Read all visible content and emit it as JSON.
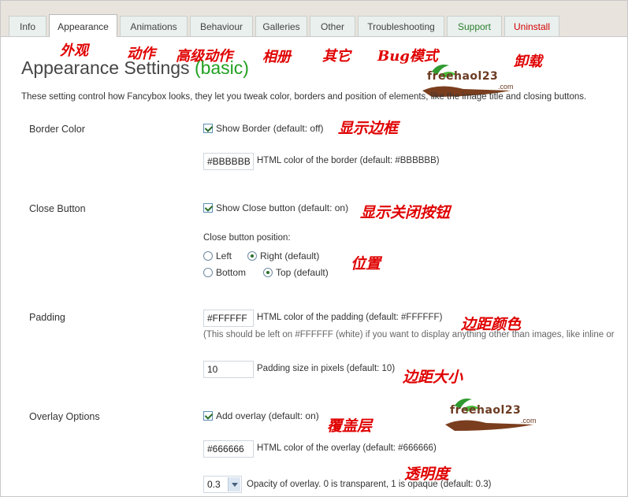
{
  "tabs": [
    {
      "label": "Info"
    },
    {
      "label": "Appearance"
    },
    {
      "label": "Animations"
    },
    {
      "label": "Behaviour"
    },
    {
      "label": "Galleries"
    },
    {
      "label": "Other"
    },
    {
      "label": "Troubleshooting"
    },
    {
      "label": "Support"
    },
    {
      "label": "Uninstall"
    }
  ],
  "annotations": {
    "appearance": "外观",
    "animations": "动作",
    "behaviour": "高级动作",
    "galleries": "相册",
    "other": "其它",
    "troubleshooting": "Bug模式",
    "uninstall": "卸载",
    "show_border": "显示边框",
    "show_close": "显示关闭按钮",
    "position": "位置",
    "padding_color": "边距颜色",
    "padding_size": "边距大小",
    "overlay": "覆盖层",
    "opacity": "透明度"
  },
  "watermark": {
    "brand": "freehaol23",
    "domain": ".com"
  },
  "page": {
    "title": "Appearance Settings",
    "title_suffix": "(basic)",
    "description": "These setting control how Fancybox looks, they let you tweak color, borders and position of elements, like the image title and closing buttons."
  },
  "border": {
    "label": "Border Color",
    "show_label": "Show Border (default: off)",
    "show_checked": true,
    "color_value": "#BBBBBB",
    "color_desc": "HTML color of the border (default: #BBBBBB)"
  },
  "close": {
    "label": "Close Button",
    "show_label": "Show Close button (default: on)",
    "show_checked": true,
    "position_label": "Close button position:",
    "opt_left": "Left",
    "opt_right": "Right (default)",
    "opt_bottom": "Bottom",
    "opt_top": "Top (default)"
  },
  "padding": {
    "label": "Padding",
    "color_value": "#FFFFFF",
    "color_desc": "HTML color of the padding (default: #FFFFFF)",
    "hint": "(This should be left on #FFFFFF (white) if you want to display anything other than images, like inline or",
    "size_value": "10",
    "size_desc": "Padding size in pixels (default: 10)"
  },
  "overlay": {
    "label": "Overlay Options",
    "add_label": "Add overlay (default: on)",
    "add_checked": true,
    "color_value": "#666666",
    "color_desc": "HTML color of the overlay (default: #666666)",
    "opacity_value": "0.3",
    "opacity_desc": "Opacity of overlay. 0 is transparent, 1 is opaque (default: 0.3)"
  }
}
